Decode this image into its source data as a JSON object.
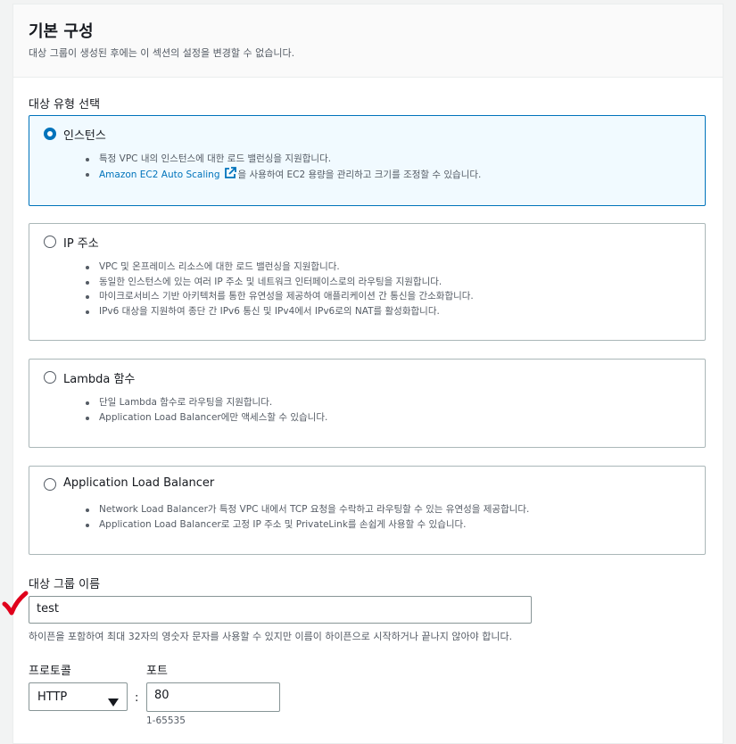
{
  "header": {
    "title": "기본 구성",
    "description": "대상 그룹이 생성된 후에는 이 섹션의 설정을 변경할 수 없습니다."
  },
  "target_type": {
    "label": "대상 유형 선택",
    "selected": "instances",
    "options": [
      {
        "title": "인스턴스",
        "bullets": [
          "특정 VPC 내의 인스턴스에 대한 로드 밸런싱을 지원합니다."
        ],
        "link_bullet": {
          "link": "Amazon EC2 Auto Scaling",
          "rest": "을 사용하여 EC2 용량을 관리하고 크기를 조정할 수 있습니다."
        }
      },
      {
        "title": "IP 주소",
        "bullets": [
          "VPC 및 온프레미스 리소스에 대한 로드 밸런싱을 지원합니다.",
          "동일한 인스턴스에 있는 여러 IP 주소 및 네트워크 인터페이스로의 라우팅을 지원합니다.",
          "마이크로서비스 기반 아키텍처를 통한 유연성을 제공하여 애플리케이션 간 통신을 간소화합니다.",
          "IPv6 대상을 지원하여 종단 간 IPv6 통신 및 IPv4에서 IPv6로의 NAT를 활성화합니다."
        ]
      },
      {
        "title": "Lambda 함수",
        "bullets": [
          "단일 Lambda 함수로 라우팅을 지원합니다.",
          "Application Load Balancer에만 액세스할 수 있습니다."
        ]
      },
      {
        "title": "Application Load Balancer",
        "bullets": [
          "Network Load Balancer가 특정 VPC 내에서 TCP 요청을 수락하고 라우팅할 수 있는 유연성을 제공합니다.",
          "Application Load Balancer로 고정 IP 주소 및 PrivateLink를 손쉽게 사용할 수 있습니다."
        ]
      }
    ]
  },
  "target_group_name": {
    "label": "대상 그룹 이름",
    "value": "test",
    "hint": "하이픈을 포함하여 최대 32자의 영숫자 문자를 사용할 수 있지만 이름이 하이픈으로 시작하거나 끝나지 않아야 합니다."
  },
  "protocol": {
    "label": "프로토콜",
    "value": "HTTP",
    "separator": ":"
  },
  "port": {
    "label": "포트",
    "value": "80",
    "hint": "1-65535"
  },
  "colors": {
    "accent": "#0073bb",
    "selected_bg": "#f1faff",
    "annotation": "#e0001b"
  }
}
